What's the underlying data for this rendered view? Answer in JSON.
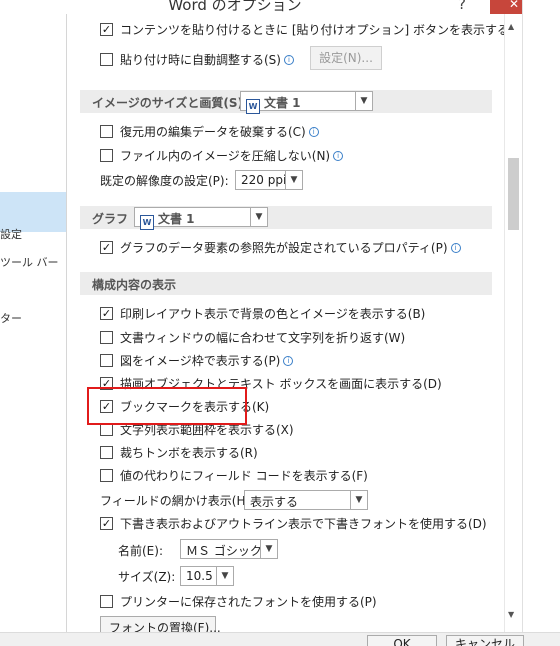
{
  "window": {
    "title": "Word のオプション",
    "help_glyph": "?",
    "close_glyph": "✕"
  },
  "nav": {
    "items": [
      "設定",
      "ツール バー",
      "ター"
    ]
  },
  "paste": {
    "cut_label": "コンテンツを貼り付けるときに [貼り付けオプション] ボタンを表示する(O)",
    "cut_checked": true,
    "auto_adjust_label": "貼り付け時に自動調整する(S)",
    "auto_adjust_checked": false,
    "settings_button": "設定(N)..."
  },
  "image_section": {
    "title": "イメージのサイズと画質(S)",
    "doc_select": "文書 1",
    "discard_label": "復元用の編集データを破棄する(C)",
    "discard_checked": false,
    "no_compress_label": "ファイル内のイメージを圧縮しない(N)",
    "no_compress_checked": false,
    "resolution_label": "既定の解像度の設定(P):",
    "resolution_value": "220 ppi"
  },
  "graph_section": {
    "title": "グラフ",
    "doc_select": "文書 1",
    "prop_label": "グラフのデータ要素の参照先が設定されているプロパティ(P)",
    "prop_checked": true
  },
  "display_section": {
    "title": "構成内容の表示",
    "options": [
      {
        "label": "印刷レイアウト表示で背景の色とイメージを表示する(B)",
        "checked": true,
        "info": false
      },
      {
        "label": "文書ウィンドウの幅に合わせて文字列を折り返す(W)",
        "checked": false,
        "info": false
      },
      {
        "label": "図をイメージ枠で表示する(P)",
        "checked": false,
        "info": true
      },
      {
        "label": "描画オブジェクトとテキスト ボックスを画面に表示する(D)",
        "checked": true,
        "info": false
      },
      {
        "label": "ブックマークを表示する(K)",
        "checked": true,
        "info": false
      },
      {
        "label": "文字列表示範囲枠を表示する(X)",
        "checked": false,
        "info": false
      },
      {
        "label": "裁ちトンボを表示する(R)",
        "checked": false,
        "info": false
      },
      {
        "label": "値の代わりにフィールド コードを表示する(F)",
        "checked": false,
        "info": false
      }
    ],
    "field_shading_label": "フィールドの網かけ表示(H):",
    "field_shading_value": "表示する",
    "draft_font_label": "下書き表示およびアウトライン表示で下書きフォントを使用する(D)",
    "draft_font_checked": true,
    "font_name_label": "名前(E):",
    "font_name_value": "ＭＳ ゴシック",
    "font_size_label": "サイズ(Z):",
    "font_size_value": "10.5",
    "printer_font_label": "プリンターに保存されたフォントを使用する(P)",
    "printer_font_checked": false,
    "font_replace_button": "フォントの置換(F)..."
  },
  "footer": {
    "ok": "OK",
    "cancel": "キャンセル"
  },
  "colors": {
    "highlight_box": "#e11b1b",
    "nav_selected": "#cde4f7",
    "section_bg": "#ececec"
  }
}
